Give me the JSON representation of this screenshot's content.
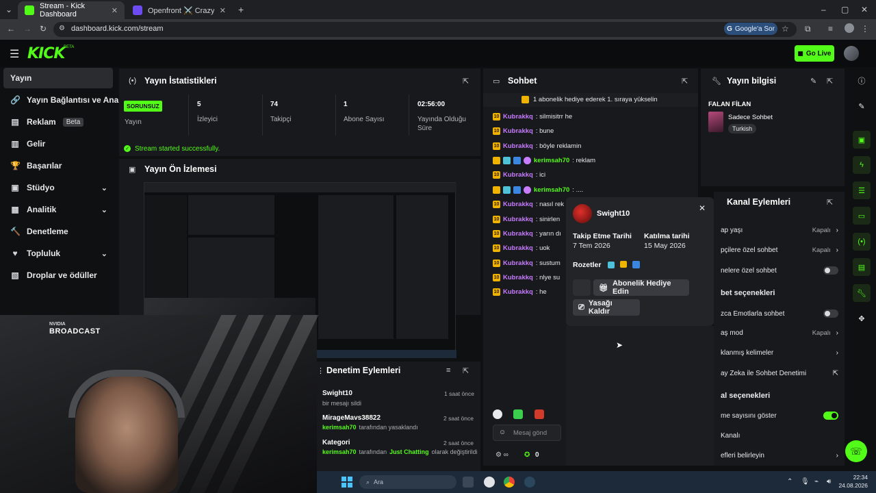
{
  "browser": {
    "tabs": [
      {
        "title": "Stream - Kick Dashboard",
        "active": true
      },
      {
        "title": "Openfront ⚔️ CrazyGames'te o",
        "active": false
      }
    ],
    "url": "dashboard.kick.com/stream",
    "google_chip": "Google'a Sor"
  },
  "header": {
    "logo": "KICK",
    "logo_beta": "BETA",
    "go_live": "Go Live"
  },
  "sidebar": {
    "items": [
      {
        "label": "Yayın",
        "icon": "broadcast-icon"
      },
      {
        "label": "Yayın Bağlantısı ve Anahtar",
        "icon": "link-icon"
      },
      {
        "label": "Reklam",
        "badge": "Beta",
        "icon": "ad-icon"
      },
      {
        "label": "Gelir",
        "icon": "revenue-icon"
      },
      {
        "label": "Başarılar",
        "icon": "trophy-icon"
      },
      {
        "label": "Stüdyo",
        "icon": "studio-icon"
      },
      {
        "label": "Analitik",
        "icon": "analytics-icon"
      },
      {
        "label": "Denetleme",
        "icon": "moderation-icon"
      },
      {
        "label": "Topluluk",
        "icon": "community-icon"
      },
      {
        "label": "Droplar ve ödüller",
        "icon": "drops-icon"
      }
    ]
  },
  "stats": {
    "title": "Yayın İstatistikleri",
    "status_badge": "SORUNSUZ",
    "status_label": "Yayın",
    "items": [
      {
        "value": "5",
        "label": "İzleyici"
      },
      {
        "value": "74",
        "label": "Takipçi"
      },
      {
        "value": "1",
        "label": "Abone Sayısı"
      },
      {
        "value": "02:56:00",
        "label": "Yayında Olduğu Süre"
      }
    ],
    "success_message": "Stream started successfully."
  },
  "preview": {
    "title": "Yayın Ön İzlemesi"
  },
  "chat": {
    "title": "Sohbet",
    "pinned": "1 abonelik hediye ederek 1. sıraya yükselin",
    "messages": [
      {
        "user": "Kubrakkq",
        "text": ": silmisitrr he",
        "vip": false
      },
      {
        "user": "Kubrakkq",
        "text": ": bune",
        "vip": false
      },
      {
        "user": "Kubrakkq",
        "text": ": böyle reklamin",
        "vip": false
      },
      {
        "user": "kerimsah70",
        "text": ": reklam",
        "vip": true
      },
      {
        "user": "Kubrakkq",
        "text": ": ici",
        "vip": false
      },
      {
        "user": "kerimsah70",
        "text": ": ....",
        "vip": true
      },
      {
        "user": "Kubrakkq",
        "text": ": nasıl rek",
        "vip": false
      },
      {
        "user": "Kubrakkq",
        "text": ": sinirlen",
        "vip": false
      },
      {
        "user": "Kubrakkq",
        "text": ": yarın dı",
        "vip": false
      },
      {
        "user": "Kubrakkq",
        "text": ": uok",
        "vip": false
      },
      {
        "user": "Kubrakkq",
        "text": ": sustum",
        "vip": false
      },
      {
        "user": "Kubrakkq",
        "text": ": nlye su",
        "vip": false
      },
      {
        "user": "Kubrakkq",
        "text": ": he",
        "vip": false
      }
    ],
    "input_placeholder": "Mesaj gönd",
    "points": "0"
  },
  "user_popup": {
    "username": "Swight10",
    "follow_label": "Takip Etme Tarihi",
    "follow_date": "7 Tem 2026",
    "join_label": "Katılma tarihi",
    "join_date": "15 May 2026",
    "badges_label": "Rozetler",
    "gift_button": "Abonelik Hediye Edin",
    "unban_button": "Yasağı Kaldır"
  },
  "mod_actions": {
    "title": "Denetim Eylemleri",
    "items": [
      {
        "user": "Swight10",
        "time": "1 saat önce",
        "detail_a": "bir mesajı sildi",
        "detail_b": ""
      },
      {
        "user": "MirageMavs38822",
        "time": "2 saat önce",
        "detail_a": "kerimsah70",
        "detail_b": "tarafından yasaklandı"
      },
      {
        "user": "Kategori",
        "time": "2 saat önce",
        "detail_a": "kerimsah70",
        "detail_b": "tarafından",
        "detail_c": "Just Chatting",
        "detail_d": "olarak değiştirildi"
      }
    ]
  },
  "stream_info": {
    "title": "Yayın bilgisi",
    "stream_title": "FALAN FİLAN",
    "category": "Sadece Sohbet",
    "tag": "Turkish"
  },
  "channel_actions": {
    "title": "Kanal Eylemleri",
    "rows": [
      {
        "label": "ap yaşı",
        "value": "Kapalı",
        "type": "select"
      },
      {
        "label": "pçilere özel sohbet",
        "value": "Kapalı",
        "type": "select"
      },
      {
        "label": "nelere özel sohbet",
        "value": "",
        "type": "toggle-off"
      },
      {
        "label": "bet seçenekleri",
        "value": "",
        "type": "section"
      },
      {
        "label": "zca Emotlarla sohbet",
        "value": "",
        "type": "toggle-off"
      },
      {
        "label": "aş mod",
        "value": "Kapalı",
        "type": "select"
      },
      {
        "label": "klanmış kelimeler",
        "value": "",
        "type": "link"
      },
      {
        "label": "ay Zeka ile Sohbet Denetimi",
        "value": "",
        "type": "external"
      },
      {
        "label": "al seçenekleri",
        "value": "",
        "type": "section"
      },
      {
        "label": "me sayısını göster",
        "value": "",
        "type": "toggle-on"
      },
      {
        "label": "Kanalı",
        "value": "",
        "type": "plain"
      },
      {
        "label": "efleri belirleyin",
        "value": "",
        "type": "link"
      }
    ]
  },
  "overlay": {
    "broadcast_brand_top": "NVIDIA",
    "broadcast_brand": "BROADCAST"
  },
  "taskbar": {
    "search_placeholder": "Ara",
    "time": "22:34",
    "date": "24.08.2026"
  },
  "colors": {
    "accent": "#53fc18",
    "username_purple": "#c87cff",
    "panel": "#18191c",
    "background": "#0f1012"
  }
}
